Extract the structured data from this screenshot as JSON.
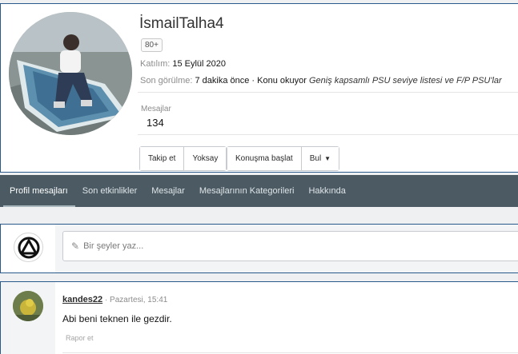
{
  "profile": {
    "username": "İsmailTalha4",
    "badge": "80+",
    "joined_label": "Katılım:",
    "joined_value": "15 Eylül 2020",
    "last_seen_label": "Son görülme:",
    "last_seen_value": "7 dakika önce · Konu okuyor",
    "last_seen_thread": "Geniş kapsamlı PSU seviye listesi ve F/P PSU'lar",
    "messages_label": "Mesajlar",
    "messages_count": "134"
  },
  "actions": {
    "follow": "Takip et",
    "ignore": "Yoksay",
    "start_conversation": "Konuşma başlat",
    "find": "Bul"
  },
  "tabs": [
    {
      "label": "Profil mesajları",
      "active": true
    },
    {
      "label": "Son etkinlikler",
      "active": false
    },
    {
      "label": "Mesajlar",
      "active": false
    },
    {
      "label": "Mesajlarının Kategorileri",
      "active": false
    },
    {
      "label": "Hakkında",
      "active": false
    }
  ],
  "compose": {
    "placeholder": "Bir şeyler yaz..."
  },
  "message": {
    "author": "kandes22",
    "time": "· Pazartesi, 15:41",
    "body": "Abi beni teknen ile gezdir.",
    "report": "Rapor et"
  },
  "icons": {
    "compose": "pencil-icon",
    "find_dropdown": "caret-down-icon",
    "site_logo": "triangle-circle-logo"
  },
  "colors": {
    "tab_bar": "#4b5a63",
    "card_border": "#2a5a8c"
  }
}
